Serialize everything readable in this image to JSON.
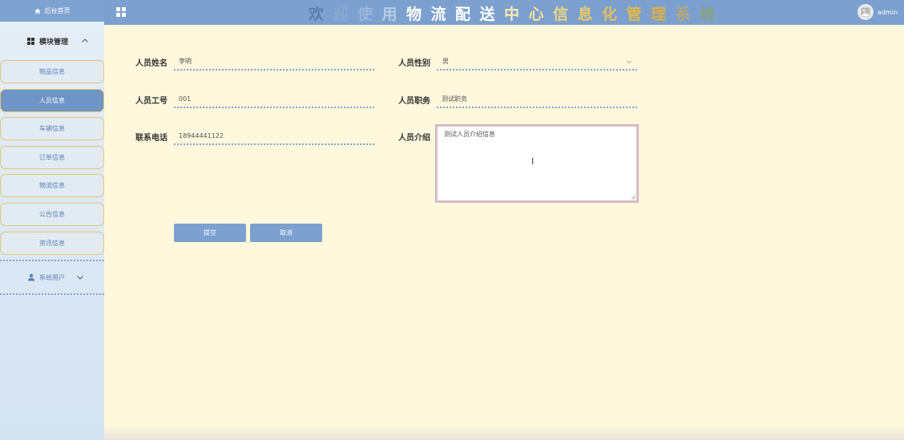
{
  "sidebar": {
    "home_label": "后台首页",
    "group_label": "模块管理",
    "items": [
      {
        "label": "物品信息"
      },
      {
        "label": "人员信息"
      },
      {
        "label": "车辆信息"
      },
      {
        "label": "订单信息"
      },
      {
        "label": "物流信息"
      },
      {
        "label": "公告信息"
      },
      {
        "label": "资讯信息"
      }
    ],
    "active_index": 1,
    "user_group_label": "系统用户"
  },
  "header": {
    "title_chars": [
      {
        "ch": "欢",
        "color": "#5b7fae"
      },
      {
        "ch": "迎",
        "color": "#8aa9cf"
      },
      {
        "ch": "使",
        "color": "#9bb6d8"
      },
      {
        "ch": "用",
        "color": "#b7cbe3"
      },
      {
        "ch": "物",
        "color": "#ffffff"
      },
      {
        "ch": "流",
        "color": "#ffffff"
      },
      {
        "ch": "配",
        "color": "#ffffff"
      },
      {
        "ch": "送",
        "color": "#ffffff"
      },
      {
        "ch": "中",
        "color": "#f7ecb3"
      },
      {
        "ch": "心",
        "color": "#f3e09a"
      },
      {
        "ch": "信",
        "color": "#eed585"
      },
      {
        "ch": "息",
        "color": "#e9c96e"
      },
      {
        "ch": "化",
        "color": "#e6c05c"
      },
      {
        "ch": "管",
        "color": "#dfb74f"
      },
      {
        "ch": "理",
        "color": "#d9b04a"
      },
      {
        "ch": "系",
        "color": "#b9a57a"
      },
      {
        "ch": "统",
        "color": "#8aa07f"
      }
    ],
    "username": "admin"
  },
  "form": {
    "name_label": "人员姓名",
    "name_value": "李明",
    "gender_label": "人员性别",
    "gender_value": "男",
    "staff_no_label": "人员工号",
    "staff_no_value": "001",
    "position_label": "人员职务",
    "position_value": "测试职务",
    "phone_label": "联系电话",
    "phone_value": "18944441122",
    "intro_label": "人员介绍",
    "intro_value": "测试人员介绍信息"
  },
  "buttons": {
    "submit": "提交",
    "cancel": "取消"
  }
}
